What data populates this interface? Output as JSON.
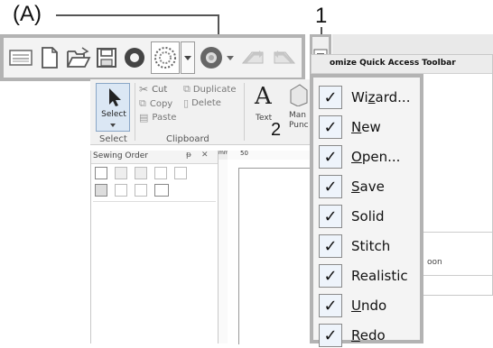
{
  "callouts": {
    "a": "(A)",
    "one": "1",
    "two": "2"
  },
  "qat_icons": [
    "ribbon-icon",
    "new-icon",
    "open-icon",
    "save-icon",
    "solid-icon",
    "stitch-icon",
    "dropdown-icon",
    "realistic-icon",
    "dropdown-icon",
    "undo-icon",
    "redo-icon"
  ],
  "menu_header": "omize Quick Access Toolbar",
  "menu": [
    {
      "pre": "Wi",
      "acc": "z",
      "post": "ard..."
    },
    {
      "pre": "",
      "acc": "N",
      "post": "ew"
    },
    {
      "pre": "",
      "acc": "O",
      "post": "pen..."
    },
    {
      "pre": "",
      "acc": "S",
      "post": "ave"
    },
    {
      "pre": "Solid",
      "acc": "",
      "post": ""
    },
    {
      "pre": "Stitch",
      "acc": "",
      "post": ""
    },
    {
      "pre": "Realistic",
      "acc": "",
      "post": ""
    },
    {
      "pre": "",
      "acc": "U",
      "post": "ndo"
    },
    {
      "pre": "",
      "acc": "R",
      "post": "edo"
    }
  ],
  "check_glyph": "✓",
  "behind_menu_text": "oon",
  "ribbon": {
    "select": "Select",
    "select_group": "Select",
    "cut": "Cut",
    "duplicate": "Duplicate",
    "copy": "Copy",
    "delete": "Delete",
    "paste": "Paste",
    "clipboard_group": "Clipboard",
    "text_letter": "A",
    "text_label": "Text",
    "man1": "Man",
    "man2": "Punc"
  },
  "sewing_panel": {
    "title": "Sewing Order",
    "pin": "ᵽ",
    "close": "✕"
  },
  "ruler": {
    "unit": "mm",
    "tick": "50"
  }
}
